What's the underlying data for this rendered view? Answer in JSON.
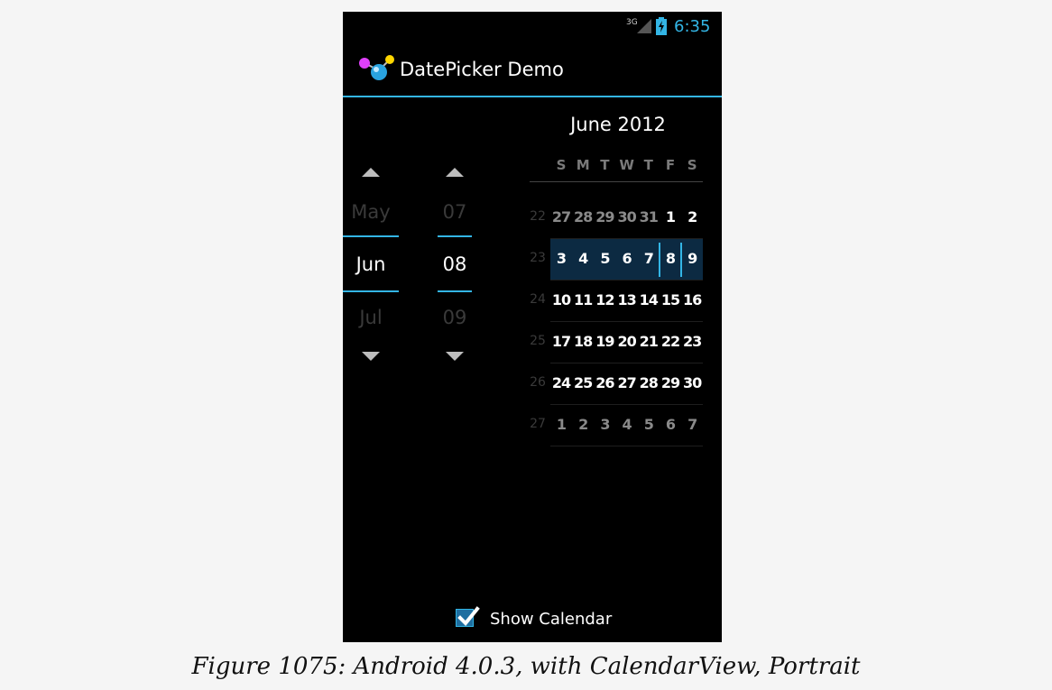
{
  "status_bar": {
    "network": "3G",
    "time": "6:35"
  },
  "action_bar": {
    "app_icon": "app-launcher-icon",
    "title": "DatePicker Demo"
  },
  "date_picker": {
    "month_spinner": {
      "prev": "May",
      "current": "Jun",
      "next": "Jul"
    },
    "day_spinner": {
      "prev": "07",
      "current": "08",
      "next": "09"
    }
  },
  "calendar": {
    "title": "June 2012",
    "weekdays": [
      "S",
      "M",
      "T",
      "W",
      "T",
      "F",
      "S"
    ],
    "weeks": [
      {
        "number": "22",
        "days": [
          "27",
          "28",
          "29",
          "30",
          "31",
          "1",
          "2"
        ],
        "in_month": [
          false,
          false,
          false,
          false,
          false,
          true,
          true
        ]
      },
      {
        "number": "23",
        "days": [
          "3",
          "4",
          "5",
          "6",
          "7",
          "8",
          "9"
        ],
        "in_month": [
          true,
          true,
          true,
          true,
          true,
          true,
          true
        ]
      },
      {
        "number": "24",
        "days": [
          "10",
          "11",
          "12",
          "13",
          "14",
          "15",
          "16"
        ],
        "in_month": [
          true,
          true,
          true,
          true,
          true,
          true,
          true
        ]
      },
      {
        "number": "25",
        "days": [
          "17",
          "18",
          "19",
          "20",
          "21",
          "22",
          "23"
        ],
        "in_month": [
          true,
          true,
          true,
          true,
          true,
          true,
          true
        ]
      },
      {
        "number": "26",
        "days": [
          "24",
          "25",
          "26",
          "27",
          "28",
          "29",
          "30"
        ],
        "in_month": [
          true,
          true,
          true,
          true,
          true,
          true,
          true
        ]
      },
      {
        "number": "27",
        "days": [
          "1",
          "2",
          "3",
          "4",
          "5",
          "6",
          "7"
        ],
        "in_month": [
          false,
          false,
          false,
          false,
          false,
          false,
          false
        ]
      }
    ],
    "selected_date": "8",
    "selected_week_index": 1,
    "accent_color": "#33b5e5"
  },
  "show_calendar": {
    "label": "Show Calendar",
    "checked": true
  },
  "caption": "Figure 1075: Android 4.0.3, with CalendarView, Portrait"
}
